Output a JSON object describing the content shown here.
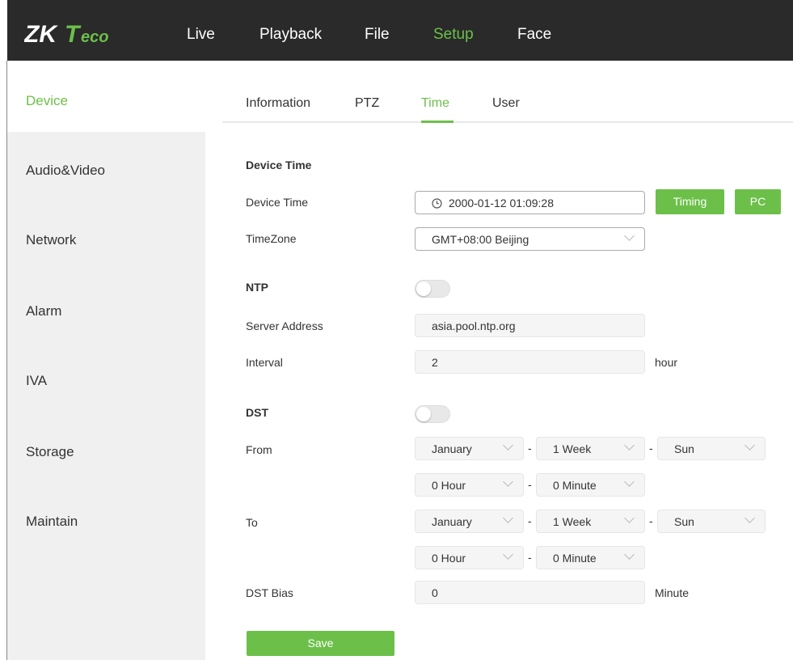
{
  "brand": {
    "logo_text": "ZKTeco",
    "accent": "#6cc049"
  },
  "nav": {
    "items": [
      {
        "label": "Live"
      },
      {
        "label": "Playback"
      },
      {
        "label": "File"
      },
      {
        "label": "Setup",
        "active": true
      },
      {
        "label": "Face"
      }
    ]
  },
  "sidebar": {
    "items": [
      {
        "label": "Device",
        "active": true
      },
      {
        "label": "Audio&Video"
      },
      {
        "label": "Network"
      },
      {
        "label": "Alarm"
      },
      {
        "label": "IVA"
      },
      {
        "label": "Storage"
      },
      {
        "label": "Maintain"
      }
    ]
  },
  "tabs": {
    "items": [
      {
        "label": "Information"
      },
      {
        "label": "PTZ"
      },
      {
        "label": "Time",
        "active": true
      },
      {
        "label": "User"
      }
    ]
  },
  "form": {
    "device_time_section": "Device Time",
    "device_time_label": "Device Time",
    "device_time_value": "2000-01-12 01:09:28",
    "timing_button": "Timing",
    "pc_button": "PC",
    "timezone_label": "TimeZone",
    "timezone_value": "GMT+08:00 Beijing",
    "ntp_section": "NTP",
    "ntp_enabled": false,
    "server_address_label": "Server Address",
    "server_address_value": "asia.pool.ntp.org",
    "interval_label": "Interval",
    "interval_value": "2",
    "interval_unit": "hour",
    "dst_section": "DST",
    "dst_enabled": false,
    "from_label": "From",
    "from_month": "January",
    "from_week": "1 Week",
    "from_day": "Sun",
    "from_hour": "0 Hour",
    "from_minute": "0 Minute",
    "to_label": "To",
    "to_month": "January",
    "to_week": "1 Week",
    "to_day": "Sun",
    "to_hour": "0 Hour",
    "to_minute": "0 Minute",
    "dash": "-",
    "dst_bias_label": "DST Bias",
    "dst_bias_value": "0",
    "dst_bias_unit": "Minute",
    "save_button": "Save"
  }
}
